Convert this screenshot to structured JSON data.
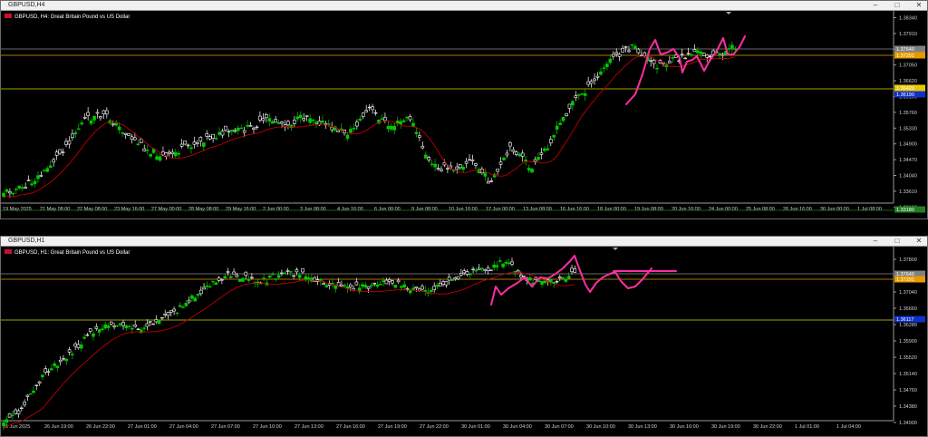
{
  "windows": [
    {
      "window_title": "GBPUSD,H4",
      "symbol_label": "GBPUSD, H4:  Great Britain Pound vs US Dollar",
      "price_ticks": [
        "1.38340",
        "1.37910",
        "1.37480",
        "1.37050",
        "1.36620",
        "1.36190",
        "1.35760",
        "1.35330",
        "1.34900",
        "1.34470",
        "1.34040",
        "1.33610",
        "1.33180"
      ],
      "price_badges": [
        {
          "text": "1.37640",
          "color": "#808080"
        },
        {
          "text": "1.37291",
          "color": "#e89a00"
        },
        {
          "text": "1.36420",
          "color": "#e8c800"
        },
        {
          "text": "1.36190",
          "color": "#1030c8"
        },
        {
          "text": "1.33180",
          "color": "#208020"
        }
      ],
      "time_ticks": [
        "19 May 2025",
        "21 May 08:00",
        "22 May 08:00",
        "23 May 16:00",
        "27 May 00:00",
        "28 May 08:00",
        "29 May 16:00",
        "2 Jun 00:00",
        "3 Jun 08:00",
        "4 Jun 16:00",
        "6 Jun 00:00",
        "9 Jun 08:00",
        "10 Jun 16:00",
        "12 Jun 00:00",
        "13 Jun 08:00",
        "16 Jun 16:00",
        "18 Jun 00:00",
        "19 Jun 08:00",
        "20 Jun 16:00",
        "24 Jun 00:00",
        "25 Jun 08:00",
        "26 Jun 16:00",
        "30 Jun 00:00",
        "1 Jul 08:00"
      ]
    },
    {
      "window_title": "GBPUSD,H1",
      "symbol_label": "GBPUSD, H1:  Great Britain Pound vs US Dollar",
      "price_ticks": [
        "1.37800",
        "1.37420",
        "1.37040",
        "1.36660",
        "1.36280",
        "1.35900",
        "1.35520",
        "1.35140",
        "1.34760",
        "1.34380",
        "1.34000"
      ],
      "price_badges": [
        {
          "text": "1.37640",
          "color": "#808080"
        },
        {
          "text": "1.37291",
          "color": "#e89a00"
        },
        {
          "text": "1.36117",
          "color": "#1030c8"
        }
      ],
      "time_ticks": [
        "26 Jun 2025",
        "26 Jun 19:00",
        "26 Jun 22:00",
        "27 Jun 01:00",
        "27 Jun 04:00",
        "27 Jun 07:00",
        "27 Jun 10:00",
        "27 Jun 13:00",
        "27 Jun 16:00",
        "27 Jun 19:00",
        "27 Jun 22:00",
        "30 Jun 01:00",
        "30 Jun 04:00",
        "30 Jun 07:00",
        "30 Jun 10:00",
        "30 Jun 13:00",
        "30 Jun 16:00",
        "30 Jun 19:00",
        "30 Jun 22:00",
        "1 Jul 01:00",
        "1 Jul 04:00"
      ]
    }
  ],
  "colors": {
    "bull": "#00c800",
    "bear": "#ffffff",
    "ma": "#c00000",
    "annotation": "#ff2ea0",
    "grid": "#3c3c3c",
    "hline_gray": "#8a8a8a",
    "hline_orange": "#e89a00",
    "hline_yellow": "#d8d800",
    "hline_green": "#208020"
  }
}
